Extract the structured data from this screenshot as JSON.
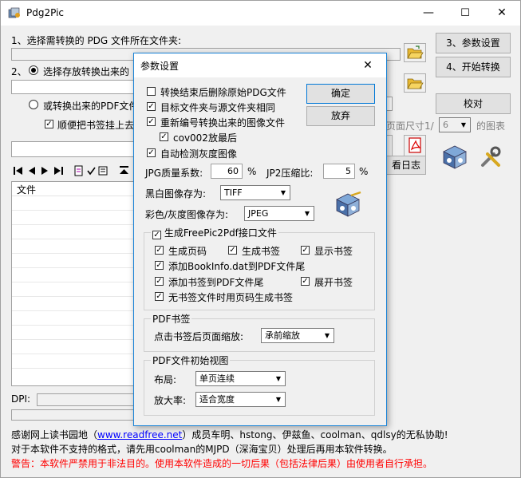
{
  "window": {
    "title": "Pdg2Pic",
    "controls": {
      "minimize": "—",
      "maximize": "☐",
      "close": "✕"
    }
  },
  "main": {
    "step1_label": "1、选择需转换的 PDG 文件所在文件夹:",
    "step2_label": "2、",
    "step2_option1": "选择存放转换出来的",
    "step2_option2": "或转换出来的PDF文件",
    "step2_sub_checkbox": "顺便把书签挂上去",
    "btn_params": "3、参数设置",
    "btn_start": "4、开始转换",
    "btn_proof": "校对",
    "page_size_label": "页面尺寸1/",
    "page_size_value": "6",
    "page_size_suffix": "的图表",
    "btn_log": "看日志",
    "file_col_header": "文件",
    "dpi_label": "DPI:",
    "footer_line1_prefix": "感谢网上读书园地（",
    "footer_link": "www.readfree.net",
    "footer_line1_suffix": "）成员车明、hstong、伊兹鱼、coolman、qdlsy的无私协助!",
    "footer_line2": "对于本软件不支持的格式，请先用coolman的MJPD（深海宝贝）处理后再用本软件转换。",
    "footer_warning": "警告：本软件严禁用于非法目的。使用本软件造成的一切后果（包括法律后果）由使用者自行承担。"
  },
  "dialog": {
    "title": "参数设置",
    "close": "✕",
    "btn_ok": "确定",
    "btn_cancel": "放弃",
    "cb_delete_pdg": {
      "label": "转换结束后删除原始PDG文件",
      "checked": false
    },
    "cb_same_folder": {
      "label": "目标文件夹与源文件夹相同",
      "checked": true
    },
    "cb_renumber": {
      "label": "重新编号转换出来的图像文件",
      "checked": true
    },
    "cb_cov002": {
      "label": "cov002放最后",
      "checked": true
    },
    "cb_auto_gray": {
      "label": "自动检测灰度图像",
      "checked": true
    },
    "jpg_quality_label": "JPG质量系数:",
    "jpg_quality_value": "60",
    "jpg_quality_unit": "%",
    "jp2_ratio_label": "JP2压缩比:",
    "jp2_ratio_value": "5",
    "jp2_ratio_unit": "%",
    "bw_save_label": "黑白图像存为:",
    "bw_save_value": "TIFF",
    "color_save_label": "彩色/灰度图像存为:",
    "color_save_value": "JPEG",
    "group_freepic": {
      "title": "生成FreePic2Pdf接口文件",
      "checked": true,
      "gen_page": {
        "label": "生成页码",
        "checked": true
      },
      "gen_bookmark": {
        "label": "生成书签",
        "checked": true
      },
      "show_bookmark": {
        "label": "显示书签",
        "checked": true
      },
      "add_bookinfo": {
        "label": "添加BookInfo.dat到PDF文件尾",
        "checked": true
      },
      "add_bookmark_tail": {
        "label": "添加书签到PDF文件尾",
        "checked": true
      },
      "expand_bookmark": {
        "label": "展开书签",
        "checked": true
      },
      "no_bookmark_page": {
        "label": "无书签文件时用页码生成书签",
        "checked": true
      }
    },
    "group_pdf_bookmark": {
      "title": "PDF书签",
      "zoom_label": "点击书签后页面缩放:",
      "zoom_value": "承前缩放"
    },
    "group_pdf_view": {
      "title": "PDF文件初始视图",
      "layout_label": "布局:",
      "layout_value": "单页连续",
      "zoom_label": "放大率:",
      "zoom_value": "适合宽度"
    }
  }
}
